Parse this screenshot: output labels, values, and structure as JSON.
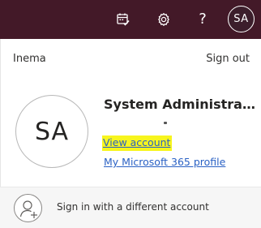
{
  "topbar": {
    "calendar_icon": "calendar-check-icon",
    "settings_icon": "gear-icon",
    "help_label": "?",
    "avatar_initials": "SA",
    "background_color": "#431928"
  },
  "account_panel": {
    "org_name": "Inema",
    "sign_out_label": "Sign out",
    "avatar_initials": "SA",
    "user_name": "System Administrat...",
    "view_account_label": "View account",
    "profile_link_label": "My Microsoft 365 profile",
    "link_color": "#2a61c4",
    "highlight_color": "#f7f51e"
  },
  "footer": {
    "icon": "add-person-icon",
    "label": "Sign in with a different account"
  }
}
